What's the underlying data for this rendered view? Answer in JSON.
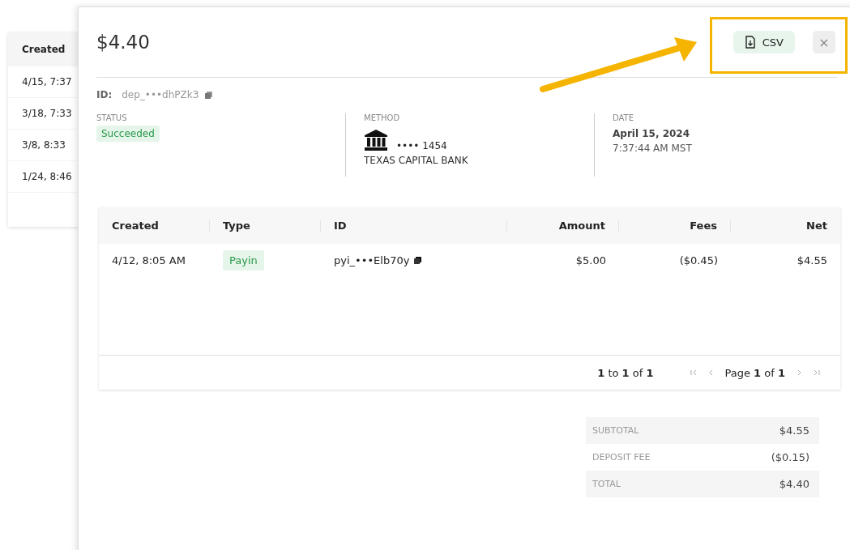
{
  "background_table": {
    "column": "Created",
    "rows": [
      "4/15, 7:37",
      "3/18, 7:33",
      "3/8, 8:33",
      "1/24, 8:46"
    ]
  },
  "modal": {
    "title": "$4.40",
    "csv_button": "CSV",
    "close": "×",
    "id_label": "ID:",
    "id_value": "dep_•••dhPZk3",
    "status": {
      "label": "STATUS",
      "value": "Succeeded"
    },
    "method": {
      "label": "METHOD",
      "account": "•••• 1454",
      "bank": "TEXAS CAPITAL BANK"
    },
    "date": {
      "label": "DATE",
      "day": "April 15, 2024",
      "time": "7:37:44 AM MST"
    },
    "table": {
      "columns": [
        "Created",
        "Type",
        "ID",
        "Amount",
        "Fees",
        "Net"
      ],
      "rows": [
        {
          "created": "4/12, 8:05 AM",
          "type": "Payin",
          "id": "pyi_•••Elb70y",
          "amount": "$5.00",
          "fees": "($0.45)",
          "net": "$4.55"
        }
      ],
      "pagination": {
        "range": "**1** to **1** of **1**",
        "page": "Page **1** of **1**"
      }
    },
    "totals": [
      {
        "label": "SUBTOTAL",
        "value": "$4.55"
      },
      {
        "label": "DEPOSIT FEE",
        "value": "($0.15)"
      },
      {
        "label": "TOTAL",
        "value": "$4.40"
      }
    ]
  }
}
